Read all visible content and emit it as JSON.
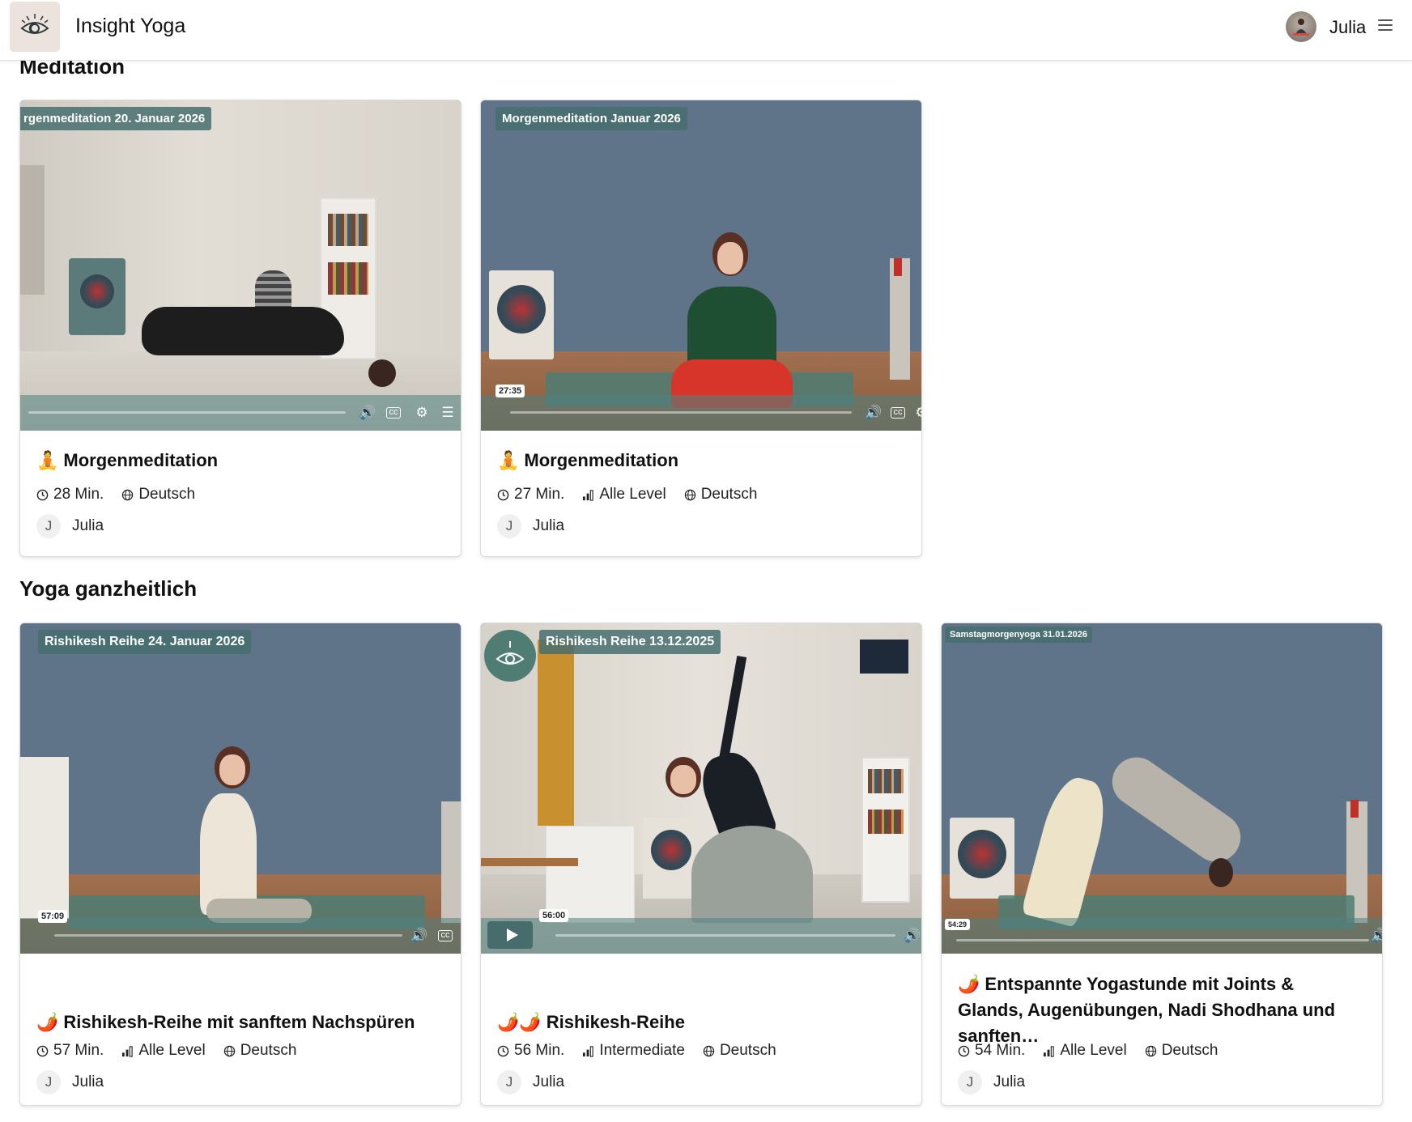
{
  "header": {
    "app_title": "Insight Yoga",
    "user_name": "Julia"
  },
  "sections": [
    {
      "title": "Meditation",
      "cards": [
        {
          "thumb_label": "rgenmeditation 20. Januar 2026",
          "emoji": "🧘",
          "title": "Morgenmeditation",
          "duration": "28 Min.",
          "level": "",
          "language": "Deutsch",
          "author_initial": "J",
          "author": "Julia"
        },
        {
          "thumb_label": "Morgenmeditation Januar 2026",
          "time_badge": "27:35",
          "emoji": "🧘",
          "title": "Morgenmeditation",
          "duration": "27 Min.",
          "level": "Alle Level",
          "language": "Deutsch",
          "author_initial": "J",
          "author": "Julia"
        }
      ]
    },
    {
      "title": "Yoga ganzheitlich",
      "cards": [
        {
          "thumb_label": "Rishikesh Reihe 24. Januar 2026",
          "time_badge": "57:09",
          "emoji": "🌶️",
          "title": "Rishikesh-Reihe mit sanftem Nachspüren",
          "duration": "57 Min.",
          "level": "Alle Level",
          "language": "Deutsch",
          "author_initial": "J",
          "author": "Julia"
        },
        {
          "thumb_label": "Rishikesh Reihe 13.12.2025",
          "time_badge": "56:00",
          "emoji": "🌶️🌶️",
          "title": "Rishikesh-Reihe",
          "duration": "56 Min.",
          "level": "Intermediate",
          "language": "Deutsch",
          "author_initial": "J",
          "author": "Julia"
        },
        {
          "thumb_label": "Samstagmorgenyoga 31.01.2026",
          "time_badge": "54:29",
          "emoji": "🌶️",
          "title": "Entspannte Yogastunde mit Joints & Glands, Augenübungen, Nadi Shodhana und sanften…",
          "duration": "54 Min.",
          "level": "Alle Level",
          "language": "Deutsch",
          "author_initial": "J",
          "author": "Julia"
        }
      ]
    }
  ],
  "icons": {
    "logo": "eye-logo-icon",
    "menu": "hamburger-menu-icon",
    "clock": "clock-icon",
    "level": "signal-bars-icon",
    "language": "globe-icon",
    "volume": "volume-icon",
    "captions": "cc-icon",
    "settings": "gear-icon",
    "play": "play-icon"
  },
  "colors": {
    "wall_blue": "#5d7286",
    "accent_teal": "#4f7d74",
    "logo_bg": "#ece3df"
  }
}
